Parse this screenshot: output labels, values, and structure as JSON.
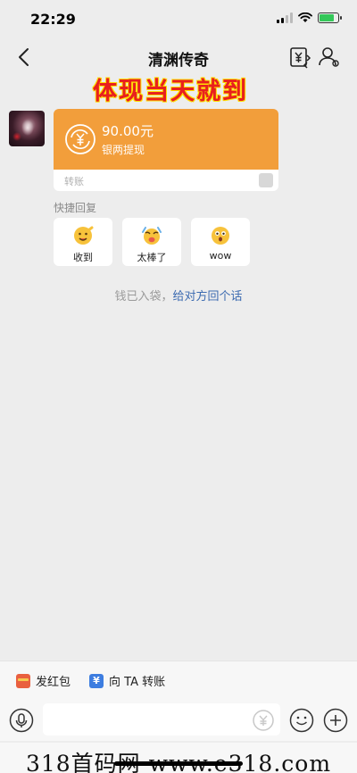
{
  "status_bar": {
    "time": "22:29"
  },
  "nav": {
    "title": "清渊传奇"
  },
  "promo": {
    "text": "体现当天就到"
  },
  "transfer": {
    "amount": "90.00元",
    "description": "银两提现",
    "label": "转账",
    "accent_color": "#f29e3b"
  },
  "quick_reply": {
    "title": "快捷回复",
    "items": [
      {
        "label": "收到",
        "icon": "received-emoji-icon"
      },
      {
        "label": "太棒了",
        "icon": "great-emoji-icon"
      },
      {
        "label": "wow",
        "icon": "wow-emoji-icon"
      }
    ]
  },
  "system_message": {
    "text": "钱已入袋，",
    "link": "给对方回个话"
  },
  "action_bar": {
    "red_packet": "发红包",
    "transfer_to": "向 TA 转账"
  },
  "watermark": {
    "text": "318首码网 www.e318.com"
  }
}
